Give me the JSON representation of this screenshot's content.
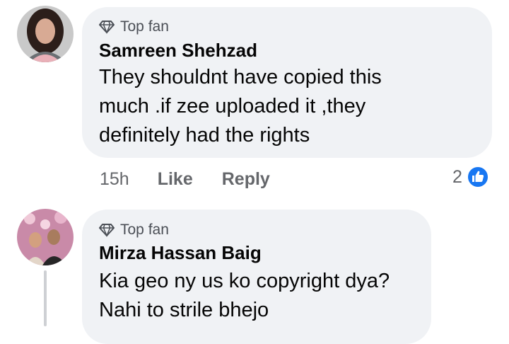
{
  "comments": [
    {
      "badge": "Top fan",
      "author": "Samreen Shehzad",
      "text_lines": [
        "They shouldnt have copied this",
        "much .if zee uploaded it ,they",
        "definitely had the rights"
      ],
      "time": "15h",
      "like_label": "Like",
      "reply_label": "Reply",
      "reaction_count": "2",
      "reaction_icon": "like-icon",
      "badge_icon": "diamond-icon"
    },
    {
      "badge": "Top fan",
      "author": "Mirza Hassan Baig",
      "text_lines": [
        "Kia geo ny us ko copyright dya?",
        "Nahi to strile bhejo"
      ],
      "badge_icon": "diamond-icon"
    }
  ],
  "colors": {
    "bubble": "#f0f2f5",
    "like_blue": "#1877f2",
    "muted": "#65676b"
  }
}
